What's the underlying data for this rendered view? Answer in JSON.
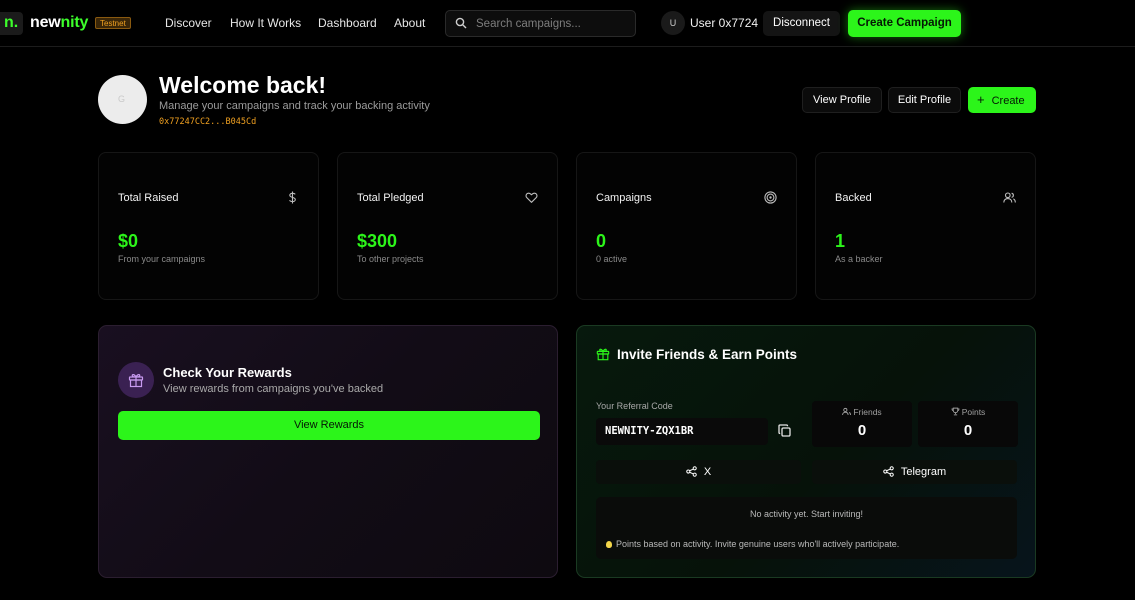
{
  "brand": {
    "logo_mark": "n.",
    "name_part1": "new",
    "name_part2": "nity",
    "badge": "Testnet"
  },
  "nav": {
    "links": [
      "Discover",
      "How It Works",
      "Dashboard",
      "About"
    ]
  },
  "search": {
    "placeholder": "Search campaigns..."
  },
  "user": {
    "initial": "U",
    "name": "User 0x7724",
    "disconnect": "Disconnect",
    "create_campaign": "Create Campaign"
  },
  "header": {
    "avatar_initial": "G",
    "title": "Welcome back!",
    "subtitle": "Manage your campaigns and track your backing activity",
    "wallet": "0x77247CC2...B045Cd",
    "view_profile": "View Profile",
    "edit_profile": "Edit Profile",
    "create": "Create"
  },
  "stats": [
    {
      "title": "Total Raised",
      "value": "$0",
      "sub": "From your campaigns",
      "icon": "dollar-icon"
    },
    {
      "title": "Total Pledged",
      "value": "$300",
      "sub": "To other projects",
      "icon": "heart-icon"
    },
    {
      "title": "Campaigns",
      "value": "0",
      "sub": "0 active",
      "icon": "target-icon"
    },
    {
      "title": "Backed",
      "value": "1",
      "sub": "As a backer",
      "icon": "users-icon"
    }
  ],
  "rewards": {
    "title": "Check Your Rewards",
    "subtitle": "View rewards from campaigns you've backed",
    "button": "View Rewards"
  },
  "invite": {
    "title": "Invite Friends & Earn Points",
    "referral_label": "Your Referral Code",
    "referral_code": "NEWNITY-ZQX1BR",
    "friends_label": "Friends",
    "friends_value": "0",
    "points_label": "Points",
    "points_value": "0",
    "share_x": "X",
    "share_telegram": "Telegram",
    "empty_activity": "No activity yet. Start inviting!",
    "tip": "Points based on activity. Invite genuine users who'll actively participate."
  },
  "colors": {
    "accent": "#2cf51a",
    "wallet": "#f0a020",
    "background": "#000000"
  }
}
